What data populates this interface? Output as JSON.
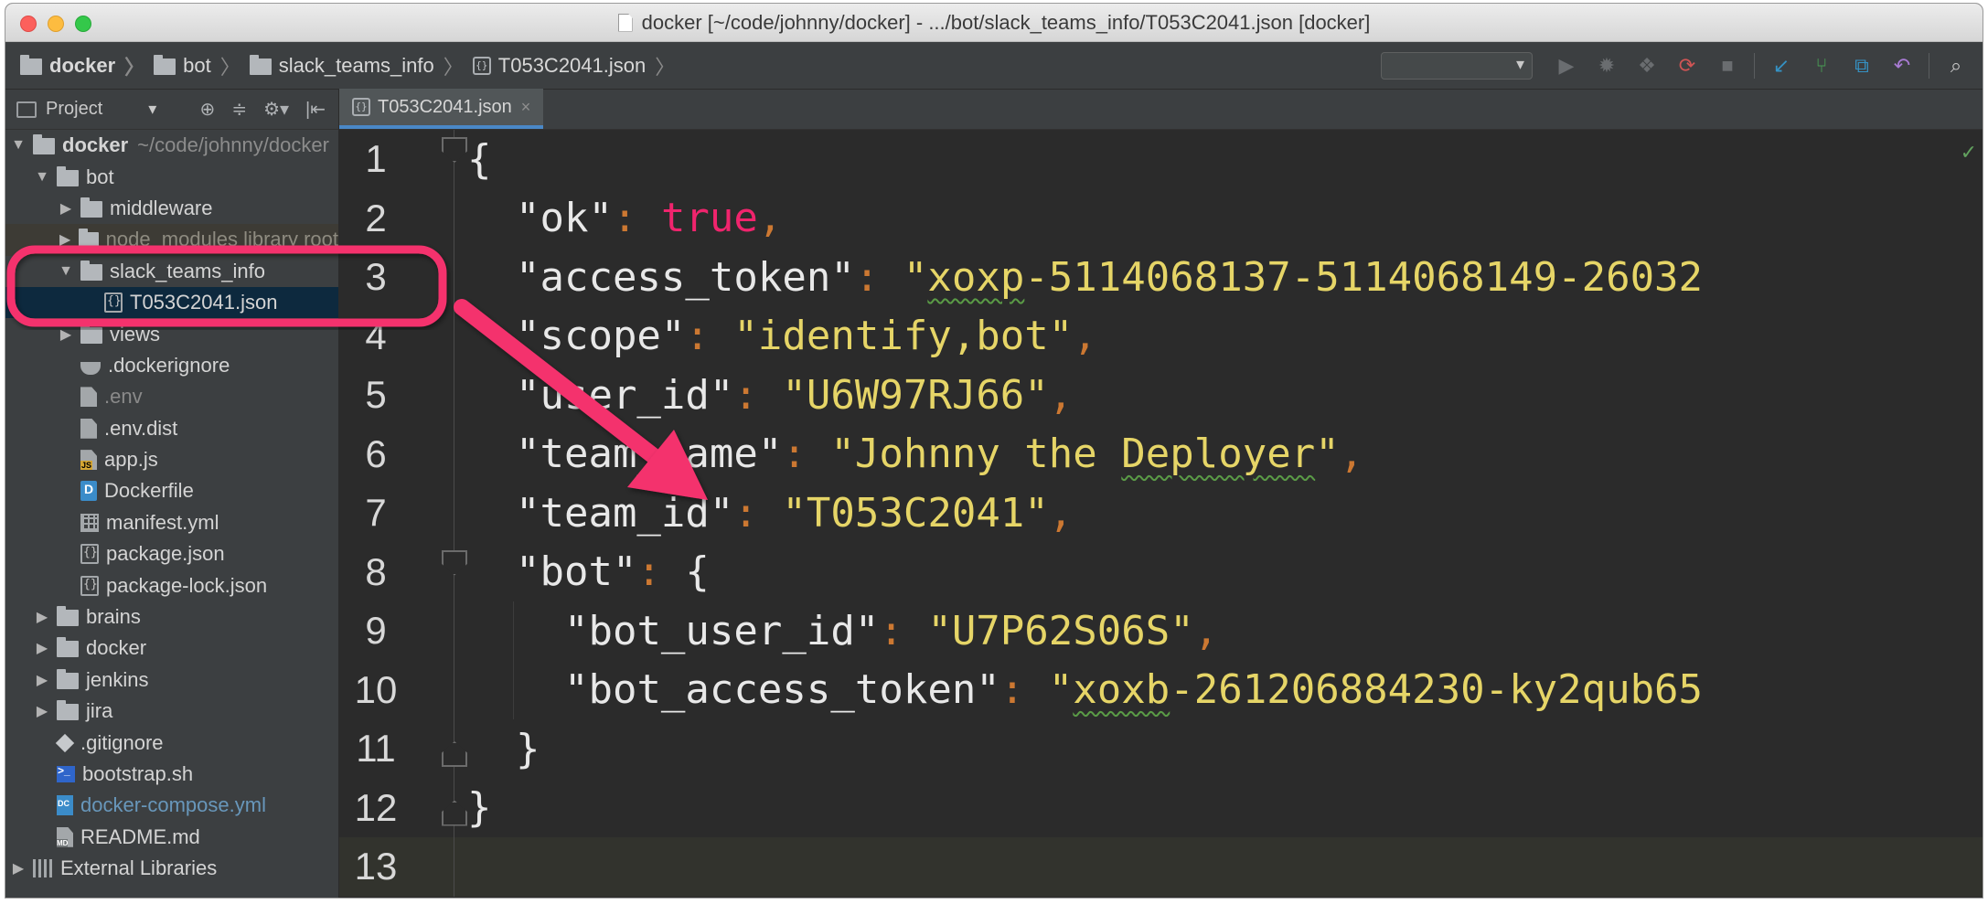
{
  "window": {
    "title": "docker [~/code/johnny/docker] - .../bot/slack_teams_info/T053C2041.json [docker]"
  },
  "breadcrumbs": [
    {
      "label": "docker",
      "kind": "folder",
      "bold": true
    },
    {
      "label": "bot",
      "kind": "folder",
      "bold": false
    },
    {
      "label": "slack_teams_info",
      "kind": "folder",
      "bold": false
    },
    {
      "label": "T053C2041.json",
      "kind": "json",
      "bold": false
    }
  ],
  "toolbar": {
    "icons": [
      "run-icon",
      "debug-icon",
      "coverage-icon",
      "rerun-icon",
      "stop-icon",
      "vcs-update-icon",
      "vcs-commit-icon",
      "vcs-history-icon",
      "revert-icon",
      "search-everywhere-icon"
    ]
  },
  "project_panel": {
    "label": "Project",
    "caret": "▾",
    "tools": [
      "⊕",
      "≑",
      "⚙▾",
      "|⇤"
    ]
  },
  "tree": [
    {
      "depth": 0,
      "arrow": "▼",
      "icon": "folder",
      "label": "docker",
      "path": "~/code/johnny/docker",
      "style": "bold"
    },
    {
      "depth": 1,
      "arrow": "▼",
      "icon": "folder",
      "label": "bot"
    },
    {
      "depth": 2,
      "arrow": "▶",
      "icon": "folder",
      "label": "middleware"
    },
    {
      "depth": 2,
      "arrow": "▶",
      "icon": "folder",
      "label": "node_modules  library root",
      "style": "excluded"
    },
    {
      "depth": 2,
      "arrow": "▼",
      "icon": "folder",
      "label": "slack_teams_info"
    },
    {
      "depth": 3,
      "arrow": "",
      "icon": "json",
      "label": "T053C2041.json",
      "style": "selected"
    },
    {
      "depth": 2,
      "arrow": "▶",
      "icon": "folder",
      "label": "views"
    },
    {
      "depth": 2,
      "arrow": "",
      "icon": "whale",
      "label": ".dockerignore"
    },
    {
      "depth": 2,
      "arrow": "",
      "icon": "file",
      "label": ".env",
      "style": "dim"
    },
    {
      "depth": 2,
      "arrow": "",
      "icon": "file",
      "label": ".env.dist"
    },
    {
      "depth": 2,
      "arrow": "",
      "icon": "js",
      "label": "app.js"
    },
    {
      "depth": 2,
      "arrow": "",
      "icon": "docker",
      "label": "Dockerfile"
    },
    {
      "depth": 2,
      "arrow": "",
      "icon": "yml",
      "label": "manifest.yml"
    },
    {
      "depth": 2,
      "arrow": "",
      "icon": "json",
      "label": "package.json"
    },
    {
      "depth": 2,
      "arrow": "",
      "icon": "json",
      "label": "package-lock.json"
    },
    {
      "depth": 1,
      "arrow": "▶",
      "icon": "folder",
      "label": "brains"
    },
    {
      "depth": 1,
      "arrow": "▶",
      "icon": "folder",
      "label": "docker"
    },
    {
      "depth": 1,
      "arrow": "▶",
      "icon": "folder",
      "label": "jenkins"
    },
    {
      "depth": 1,
      "arrow": "▶",
      "icon": "folder",
      "label": "jira"
    },
    {
      "depth": 1,
      "arrow": "",
      "icon": "git",
      "label": ".gitignore"
    },
    {
      "depth": 1,
      "arrow": "",
      "icon": "sh",
      "label": "bootstrap.sh"
    },
    {
      "depth": 1,
      "arrow": "",
      "icon": "dc",
      "label": "docker-compose.yml",
      "style": "link"
    },
    {
      "depth": 1,
      "arrow": "",
      "icon": "md",
      "label": "README.md"
    },
    {
      "depth": 0,
      "arrow": "▶",
      "icon": "lib",
      "label": "External Libraries"
    }
  ],
  "editor": {
    "tab_label": "T053C2041.json",
    "tab_close": "×",
    "status_check": "✓",
    "lines": [
      {
        "n": "1",
        "tokens": [
          {
            "t": "{",
            "c": "brace"
          }
        ]
      },
      {
        "n": "2",
        "tokens": [
          {
            "t": "  "
          },
          {
            "t": "\"ok\"",
            "c": "k"
          },
          {
            "t": ": ",
            "c": "punc"
          },
          {
            "t": "true",
            "c": "bool"
          },
          {
            "t": ",",
            "c": "punc"
          }
        ]
      },
      {
        "n": "3",
        "tokens": [
          {
            "t": "  "
          },
          {
            "t": "\"access_token\"",
            "c": "k"
          },
          {
            "t": ": ",
            "c": "punc"
          },
          {
            "t": "\"",
            "c": "str"
          },
          {
            "t": "xoxp",
            "c": "str squig"
          },
          {
            "t": "-5114068137-5114068149-26032",
            "c": "str"
          }
        ]
      },
      {
        "n": "4",
        "tokens": [
          {
            "t": "  "
          },
          {
            "t": "\"scope\"",
            "c": "k"
          },
          {
            "t": ": ",
            "c": "punc"
          },
          {
            "t": "\"identify,bot\"",
            "c": "str"
          },
          {
            "t": ",",
            "c": "punc"
          }
        ]
      },
      {
        "n": "5",
        "tokens": [
          {
            "t": "  "
          },
          {
            "t": "\"user_id\"",
            "c": "k"
          },
          {
            "t": ": ",
            "c": "punc"
          },
          {
            "t": "\"U6W97RJ66\"",
            "c": "str"
          },
          {
            "t": ",",
            "c": "punc"
          }
        ]
      },
      {
        "n": "6",
        "tokens": [
          {
            "t": "  "
          },
          {
            "t": "\"team_name\"",
            "c": "k"
          },
          {
            "t": ": ",
            "c": "punc"
          },
          {
            "t": "\"Johnny the ",
            "c": "str"
          },
          {
            "t": "Deployer",
            "c": "str squig"
          },
          {
            "t": "\"",
            "c": "str"
          },
          {
            "t": ",",
            "c": "punc"
          }
        ]
      },
      {
        "n": "7",
        "tokens": [
          {
            "t": "  "
          },
          {
            "t": "\"team_id\"",
            "c": "k"
          },
          {
            "t": ": ",
            "c": "punc"
          },
          {
            "t": "\"T053C2041\"",
            "c": "str"
          },
          {
            "t": ",",
            "c": "punc"
          }
        ]
      },
      {
        "n": "8",
        "tokens": [
          {
            "t": "  "
          },
          {
            "t": "\"bot\"",
            "c": "k"
          },
          {
            "t": ": ",
            "c": "punc"
          },
          {
            "t": "{",
            "c": "brace"
          }
        ]
      },
      {
        "n": "9",
        "tokens": [
          {
            "t": "    "
          },
          {
            "t": "\"bot_user_id\"",
            "c": "k"
          },
          {
            "t": ": ",
            "c": "punc"
          },
          {
            "t": "\"U7P62S06S\"",
            "c": "str"
          },
          {
            "t": ",",
            "c": "punc"
          }
        ]
      },
      {
        "n": "10",
        "tokens": [
          {
            "t": "    "
          },
          {
            "t": "\"bot_access_token\"",
            "c": "k"
          },
          {
            "t": ": ",
            "c": "punc"
          },
          {
            "t": "\"",
            "c": "str"
          },
          {
            "t": "xoxb",
            "c": "str squig"
          },
          {
            "t": "-261206884230-ky2qub65",
            "c": "str"
          }
        ]
      },
      {
        "n": "11",
        "tokens": [
          {
            "t": "  "
          },
          {
            "t": "}",
            "c": "brace"
          }
        ]
      },
      {
        "n": "12",
        "tokens": [
          {
            "t": "}",
            "c": "brace"
          }
        ]
      },
      {
        "n": "13",
        "tokens": [],
        "current": true
      }
    ]
  },
  "colors": {
    "annotation": "#f4306d",
    "editor_bg": "#2b2b2b",
    "panel_bg": "#3c3f41",
    "selection": "#0d293e",
    "string": "#e6d567",
    "boolean": "#f0246d",
    "punctuation": "#cc7832"
  }
}
